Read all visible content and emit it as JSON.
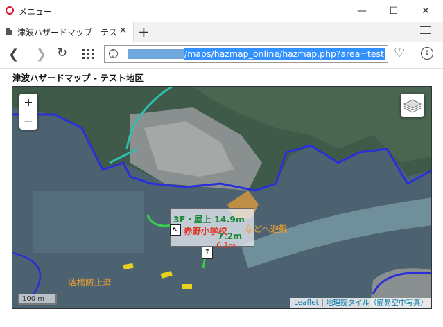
{
  "window": {
    "title": "メニュー"
  },
  "tabs": [
    {
      "label": "津波ハザードマップ - テスト地図"
    }
  ],
  "address": {
    "url": "/maps/hazmap_online/hazmap.php?area=test"
  },
  "page": {
    "title": "津波ハザードマップ - テスト地区"
  },
  "map": {
    "zoom_in": "+",
    "zoom_out": "−",
    "labels": {
      "floor_roof": "3F・屋上 14.9m",
      "school": "赤野小学校",
      "evac": "などへ避難",
      "depth1": "7.2m",
      "depth2": "6.1m",
      "bridge": "落橋防止済"
    },
    "scale": "100 m",
    "attribution": {
      "leaflet": "Leaflet",
      "sep": "|",
      "tiles": "地理院タイル（簡易空中写真）"
    }
  },
  "colors": {
    "accent": "#3390ff",
    "label_orange": "#f0a030",
    "label_red": "#e03020",
    "label_green": "#1a8a3a"
  }
}
